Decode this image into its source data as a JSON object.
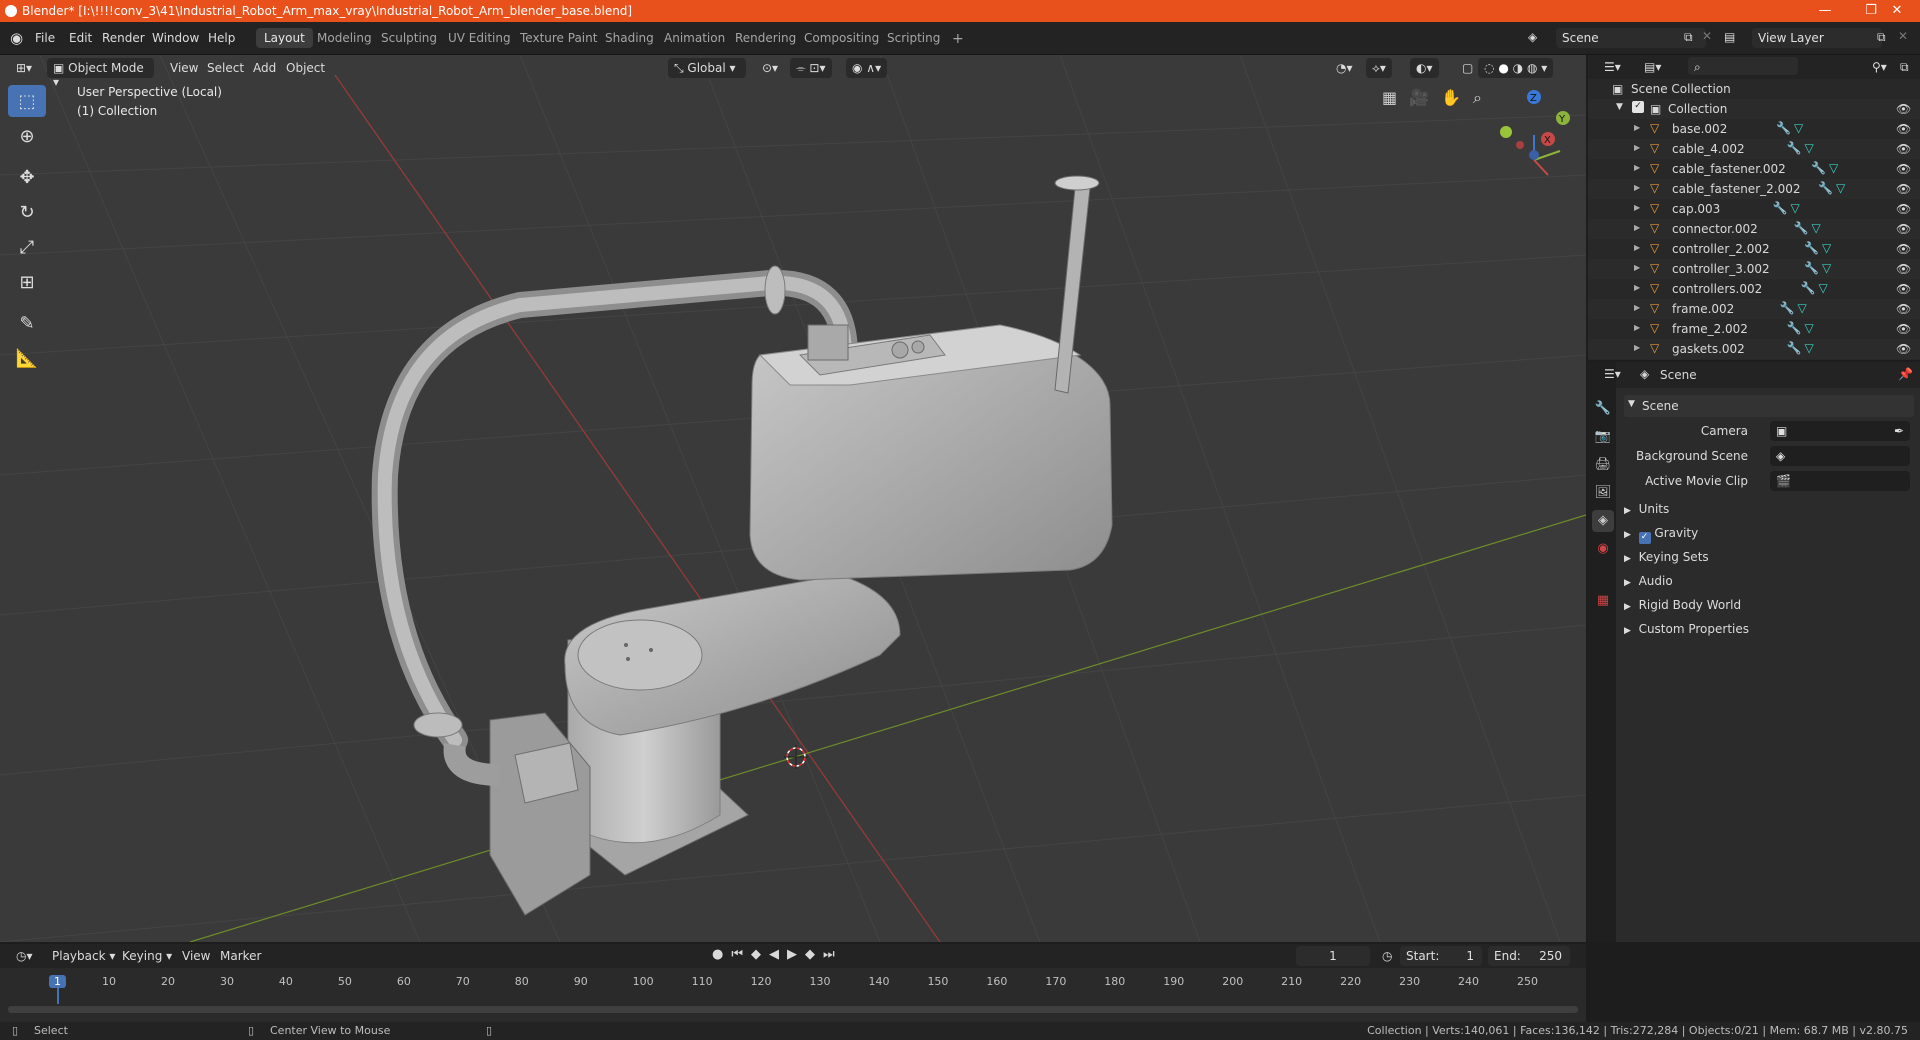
{
  "title": "Blender* [I:\\!!!!conv_3\\41\\Industrial_Robot_Arm_max_vray\\Industrial_Robot_Arm_blender_base.blend]",
  "window_controls": [
    "—",
    "❐",
    "✕"
  ],
  "menu": [
    "File",
    "Edit",
    "Render",
    "Window",
    "Help"
  ],
  "workspaces": [
    "Layout",
    "Modeling",
    "Sculpting",
    "UV Editing",
    "Texture Paint",
    "Shading",
    "Animation",
    "Rendering",
    "Compositing",
    "Scripting"
  ],
  "active_workspace": "Layout",
  "scene_name": "Scene",
  "view_layer": "View Layer",
  "viewport": {
    "mode": "Object Mode",
    "menus": [
      "View",
      "Select",
      "Add",
      "Object"
    ],
    "transform_orientation": "Global",
    "perspective_label": "User Perspective (Local)",
    "collection_label": "(1) Collection",
    "axes": {
      "x": "X",
      "y": "Y",
      "z": "Z"
    }
  },
  "outliner": {
    "scene_collection": "Scene Collection",
    "collection": "Collection",
    "items": [
      "base.002",
      "cable_4.002",
      "cable_fastener.002",
      "cable_fastener_2.002",
      "cap.003",
      "connector.002",
      "controller_2.002",
      "controller_3.002",
      "controllers.002",
      "frame.002",
      "frame_2.002",
      "gaskets.002"
    ]
  },
  "properties": {
    "header": "Scene",
    "panel": "Scene",
    "camera_label": "Camera",
    "background_scene_label": "Background Scene",
    "active_movie_clip_label": "Active Movie Clip",
    "subpanels": [
      "Units",
      "Gravity",
      "Keying Sets",
      "Audio",
      "Rigid Body World",
      "Custom Properties"
    ],
    "gravity_checked": true
  },
  "timeline": {
    "menus": [
      "Playback",
      "Keying",
      "View",
      "Marker"
    ],
    "current_frame": "1",
    "start_label": "Start:",
    "start": "1",
    "end_label": "End:",
    "end": "250",
    "ruler": [
      "1",
      "10",
      "20",
      "30",
      "40",
      "50",
      "60",
      "70",
      "80",
      "90",
      "100",
      "110",
      "120",
      "130",
      "140",
      "150",
      "160",
      "170",
      "180",
      "190",
      "200",
      "210",
      "220",
      "230",
      "240",
      "250"
    ]
  },
  "statusbar": {
    "left": "Select",
    "middle": "Center View to Mouse",
    "right": "Collection | Verts:140,061 | Faces:136,142 | Tris:272,284 | Objects:0/21 | Mem: 68.7 MB | v2.80.75"
  },
  "colors": {
    "titlebar": "#e8501c",
    "accent": "#4772b3",
    "viewport_bg": "#3a3a3a",
    "x_axis": "#c84848",
    "y_axis": "#8cb43a",
    "z_axis": "#3a78d8"
  }
}
